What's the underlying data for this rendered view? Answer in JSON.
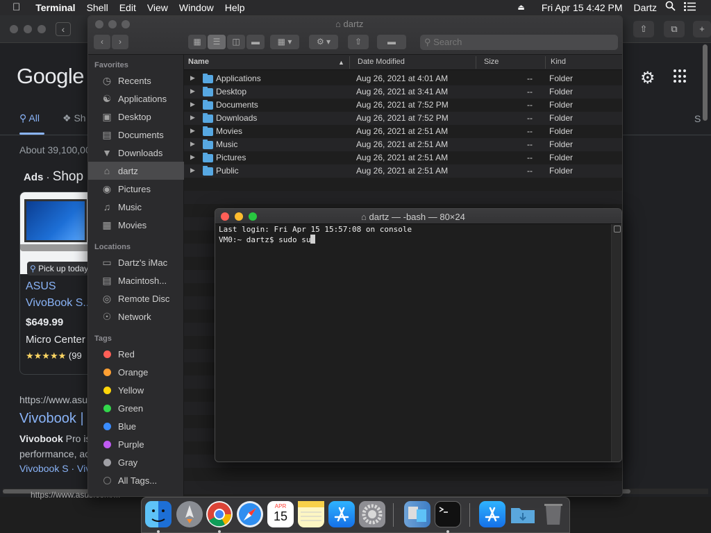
{
  "menubar": {
    "apple_icon": "apple-icon",
    "app_name": "Terminal",
    "menus": [
      "Shell",
      "Edit",
      "View",
      "Window",
      "Help"
    ],
    "datetime": "Fri Apr 15  4:42 PM",
    "user": "Dartz"
  },
  "browser": {
    "logo": "Google",
    "tab_all": "All",
    "tab_shopping": "Sh",
    "tab_right": "S",
    "results_count": "About 39,100,00",
    "ads_label": "Ads",
    "shop_label": "Shop",
    "product": {
      "pickup": "Pick up today",
      "brand": "ASUS",
      "model": "VivoBook S...",
      "price": "$649.99",
      "store": "Micro Center",
      "stars": "★★★★★",
      "reviews": "(99"
    },
    "result_url": "https://www.asu",
    "result_title": "Vivobook |",
    "snippet_bold": "Vivobook",
    "snippet_1": " Pro is",
    "snippet_2": "performance, ac",
    "sitelinks": "Vivobook S · Viv",
    "bottom_url": "https://www.asus.com/..."
  },
  "finder": {
    "title": "dartz",
    "search_placeholder": "Search",
    "favorites_header": "Favorites",
    "favorites": [
      {
        "label": "Recents",
        "icon": "clock-icon"
      },
      {
        "label": "Applications",
        "icon": "applications-icon"
      },
      {
        "label": "Desktop",
        "icon": "desktop-icon"
      },
      {
        "label": "Documents",
        "icon": "document-icon"
      },
      {
        "label": "Downloads",
        "icon": "download-icon"
      },
      {
        "label": "dartz",
        "icon": "home-icon"
      },
      {
        "label": "Pictures",
        "icon": "camera-icon"
      },
      {
        "label": "Music",
        "icon": "music-icon"
      },
      {
        "label": "Movies",
        "icon": "film-icon"
      }
    ],
    "locations_header": "Locations",
    "locations": [
      {
        "label": "Dartz's iMac",
        "icon": "imac-icon"
      },
      {
        "label": "Macintosh...",
        "icon": "disk-icon"
      },
      {
        "label": "Remote Disc",
        "icon": "disc-icon"
      },
      {
        "label": "Network",
        "icon": "globe-icon"
      }
    ],
    "tags_header": "Tags",
    "tags": [
      {
        "label": "Red",
        "color": "#ff5f57"
      },
      {
        "label": "Orange",
        "color": "#ffa033"
      },
      {
        "label": "Yellow",
        "color": "#ffd60a"
      },
      {
        "label": "Green",
        "color": "#32d74b"
      },
      {
        "label": "Blue",
        "color": "#3a8cff"
      },
      {
        "label": "Purple",
        "color": "#bf5af2"
      },
      {
        "label": "Gray",
        "color": "#a0a0a5"
      }
    ],
    "all_tags": "All Tags...",
    "columns": {
      "name": "Name",
      "date": "Date Modified",
      "size": "Size",
      "kind": "Kind"
    },
    "rows": [
      {
        "name": "Applications",
        "date": "Aug 26, 2021 at 4:01 AM",
        "size": "--",
        "kind": "Folder"
      },
      {
        "name": "Desktop",
        "date": "Aug 26, 2021 at 3:41 AM",
        "size": "--",
        "kind": "Folder"
      },
      {
        "name": "Documents",
        "date": "Aug 26, 2021 at 7:52 PM",
        "size": "--",
        "kind": "Folder"
      },
      {
        "name": "Downloads",
        "date": "Aug 26, 2021 at 7:52 PM",
        "size": "--",
        "kind": "Folder"
      },
      {
        "name": "Movies",
        "date": "Aug 26, 2021 at 2:51 AM",
        "size": "--",
        "kind": "Folder"
      },
      {
        "name": "Music",
        "date": "Aug 26, 2021 at 2:51 AM",
        "size": "--",
        "kind": "Folder"
      },
      {
        "name": "Pictures",
        "date": "Aug 26, 2021 at 2:51 AM",
        "size": "--",
        "kind": "Folder"
      },
      {
        "name": "Public",
        "date": "Aug 26, 2021 at 2:51 AM",
        "size": "--",
        "kind": "Folder"
      }
    ]
  },
  "terminal": {
    "title": "dartz — -bash — 80×24",
    "line1": "Last login: Fri Apr 15 15:57:08 on console",
    "prompt": "VM0:~ dartz$ sudo su"
  },
  "dock": {
    "apps": [
      "finder-icon",
      "launchpad-icon",
      "chrome-icon",
      "safari-icon",
      "calendar-icon",
      "notes-icon",
      "app-store-icon",
      "system-preferences-icon",
      "migration-assistant-icon",
      "terminal-icon",
      "app-store-folder-icon",
      "downloads-folder-icon",
      "trash-icon"
    ],
    "calendar_month": "APR",
    "calendar_day": "15"
  }
}
